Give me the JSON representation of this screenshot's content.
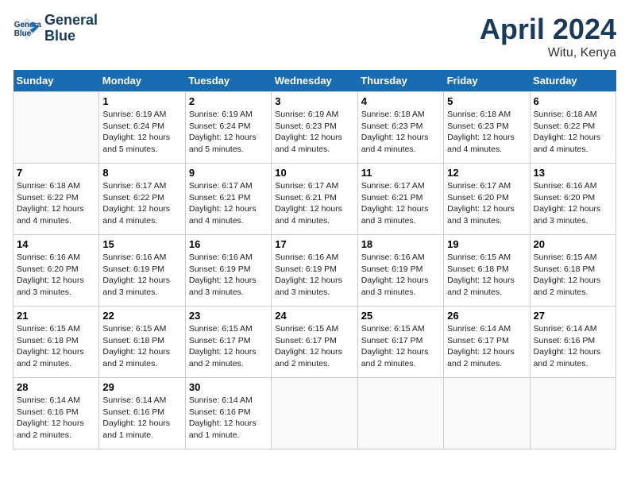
{
  "header": {
    "logo_line1": "General",
    "logo_line2": "Blue",
    "month": "April 2024",
    "location": "Witu, Kenya"
  },
  "columns": [
    "Sunday",
    "Monday",
    "Tuesday",
    "Wednesday",
    "Thursday",
    "Friday",
    "Saturday"
  ],
  "weeks": [
    [
      {
        "day": "",
        "info": ""
      },
      {
        "day": "1",
        "info": "Sunrise: 6:19 AM\nSunset: 6:24 PM\nDaylight: 12 hours\nand 5 minutes."
      },
      {
        "day": "2",
        "info": "Sunrise: 6:19 AM\nSunset: 6:24 PM\nDaylight: 12 hours\nand 5 minutes."
      },
      {
        "day": "3",
        "info": "Sunrise: 6:19 AM\nSunset: 6:23 PM\nDaylight: 12 hours\nand 4 minutes."
      },
      {
        "day": "4",
        "info": "Sunrise: 6:18 AM\nSunset: 6:23 PM\nDaylight: 12 hours\nand 4 minutes."
      },
      {
        "day": "5",
        "info": "Sunrise: 6:18 AM\nSunset: 6:23 PM\nDaylight: 12 hours\nand 4 minutes."
      },
      {
        "day": "6",
        "info": "Sunrise: 6:18 AM\nSunset: 6:22 PM\nDaylight: 12 hours\nand 4 minutes."
      }
    ],
    [
      {
        "day": "7",
        "info": "Sunrise: 6:18 AM\nSunset: 6:22 PM\nDaylight: 12 hours\nand 4 minutes."
      },
      {
        "day": "8",
        "info": "Sunrise: 6:17 AM\nSunset: 6:22 PM\nDaylight: 12 hours\nand 4 minutes."
      },
      {
        "day": "9",
        "info": "Sunrise: 6:17 AM\nSunset: 6:21 PM\nDaylight: 12 hours\nand 4 minutes."
      },
      {
        "day": "10",
        "info": "Sunrise: 6:17 AM\nSunset: 6:21 PM\nDaylight: 12 hours\nand 4 minutes."
      },
      {
        "day": "11",
        "info": "Sunrise: 6:17 AM\nSunset: 6:21 PM\nDaylight: 12 hours\nand 3 minutes."
      },
      {
        "day": "12",
        "info": "Sunrise: 6:17 AM\nSunset: 6:20 PM\nDaylight: 12 hours\nand 3 minutes."
      },
      {
        "day": "13",
        "info": "Sunrise: 6:16 AM\nSunset: 6:20 PM\nDaylight: 12 hours\nand 3 minutes."
      }
    ],
    [
      {
        "day": "14",
        "info": "Sunrise: 6:16 AM\nSunset: 6:20 PM\nDaylight: 12 hours\nand 3 minutes."
      },
      {
        "day": "15",
        "info": "Sunrise: 6:16 AM\nSunset: 6:19 PM\nDaylight: 12 hours\nand 3 minutes."
      },
      {
        "day": "16",
        "info": "Sunrise: 6:16 AM\nSunset: 6:19 PM\nDaylight: 12 hours\nand 3 minutes."
      },
      {
        "day": "17",
        "info": "Sunrise: 6:16 AM\nSunset: 6:19 PM\nDaylight: 12 hours\nand 3 minutes."
      },
      {
        "day": "18",
        "info": "Sunrise: 6:16 AM\nSunset: 6:19 PM\nDaylight: 12 hours\nand 3 minutes."
      },
      {
        "day": "19",
        "info": "Sunrise: 6:15 AM\nSunset: 6:18 PM\nDaylight: 12 hours\nand 2 minutes."
      },
      {
        "day": "20",
        "info": "Sunrise: 6:15 AM\nSunset: 6:18 PM\nDaylight: 12 hours\nand 2 minutes."
      }
    ],
    [
      {
        "day": "21",
        "info": "Sunrise: 6:15 AM\nSunset: 6:18 PM\nDaylight: 12 hours\nand 2 minutes."
      },
      {
        "day": "22",
        "info": "Sunrise: 6:15 AM\nSunset: 6:18 PM\nDaylight: 12 hours\nand 2 minutes."
      },
      {
        "day": "23",
        "info": "Sunrise: 6:15 AM\nSunset: 6:17 PM\nDaylight: 12 hours\nand 2 minutes."
      },
      {
        "day": "24",
        "info": "Sunrise: 6:15 AM\nSunset: 6:17 PM\nDaylight: 12 hours\nand 2 minutes."
      },
      {
        "day": "25",
        "info": "Sunrise: 6:15 AM\nSunset: 6:17 PM\nDaylight: 12 hours\nand 2 minutes."
      },
      {
        "day": "26",
        "info": "Sunrise: 6:14 AM\nSunset: 6:17 PM\nDaylight: 12 hours\nand 2 minutes."
      },
      {
        "day": "27",
        "info": "Sunrise: 6:14 AM\nSunset: 6:16 PM\nDaylight: 12 hours\nand 2 minutes."
      }
    ],
    [
      {
        "day": "28",
        "info": "Sunrise: 6:14 AM\nSunset: 6:16 PM\nDaylight: 12 hours\nand 2 minutes."
      },
      {
        "day": "29",
        "info": "Sunrise: 6:14 AM\nSunset: 6:16 PM\nDaylight: 12 hours\nand 1 minute."
      },
      {
        "day": "30",
        "info": "Sunrise: 6:14 AM\nSunset: 6:16 PM\nDaylight: 12 hours\nand 1 minute."
      },
      {
        "day": "",
        "info": ""
      },
      {
        "day": "",
        "info": ""
      },
      {
        "day": "",
        "info": ""
      },
      {
        "day": "",
        "info": ""
      }
    ]
  ]
}
